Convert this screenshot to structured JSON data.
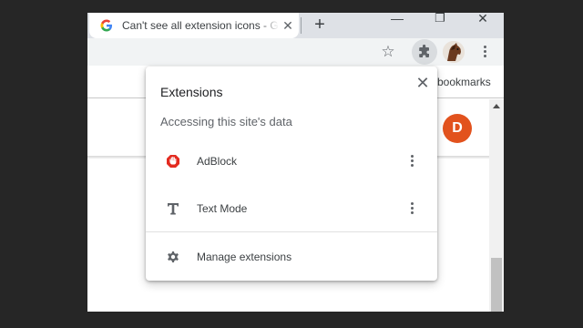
{
  "tab": {
    "title": "Can't see all extension icons - G",
    "favicon": "google-g-icon",
    "close_glyph": "✕"
  },
  "tabstrip": {
    "new_tab_glyph": "+",
    "minimize_glyph": "—",
    "restore_glyph": "❐",
    "close_glyph": "✕"
  },
  "toolbar": {
    "star_glyph": "☆",
    "extensions_icon": "puzzle-piece-icon",
    "profile_icon": "horse-avatar"
  },
  "bookmarks": {
    "label": "bookmarks"
  },
  "page": {
    "avatar_letter": "D",
    "avatar_color": "#e2521d"
  },
  "popup": {
    "title": "Extensions",
    "close_glyph": "✕",
    "subtitle": "Accessing this site's data",
    "extensions": [
      {
        "name": "AdBlock",
        "icon": "adblock-icon"
      },
      {
        "name": "Text Mode",
        "icon": "text-mode-icon"
      }
    ],
    "manage_label": "Manage extensions",
    "manage_icon": "gear-icon"
  },
  "colors": {
    "adblock_red": "#e32b20",
    "tabstrip": "#dee1e6",
    "toolbar": "#f1f3f4"
  }
}
